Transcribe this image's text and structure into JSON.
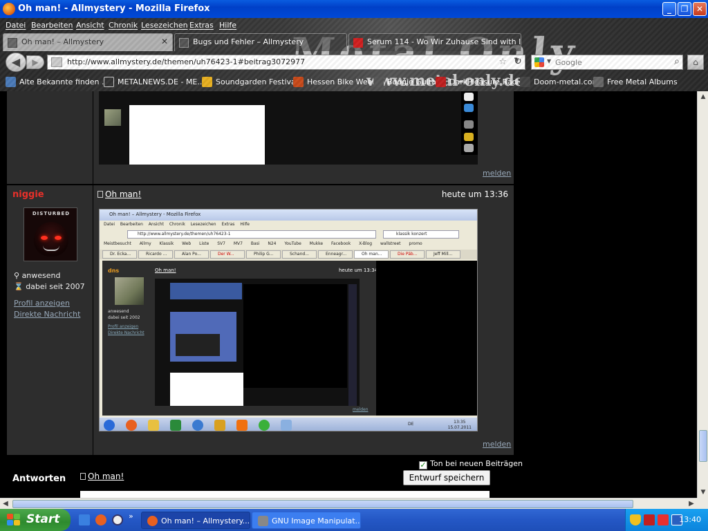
{
  "window": {
    "title": "Oh man! - Allmystery - Mozilla Firefox",
    "controls": [
      "_",
      "❐",
      "✕"
    ]
  },
  "menu": [
    "Datei",
    "Bearbeiten",
    "Ansicht",
    "Chronik",
    "Lesezeichen",
    "Extras",
    "Hilfe"
  ],
  "theme": {
    "logo": "Metal Only",
    "url": "www.metal-only.de"
  },
  "tabs": [
    {
      "label": "Oh man! – Allmystery",
      "active": true,
      "close": "✕"
    },
    {
      "label": "Bugs und Fehler – Allmystery",
      "active": false
    },
    {
      "label": "Serum 114 - Wo Wir Zuhause Sind with ly...",
      "active": false
    }
  ],
  "nav": {
    "url": "http://www.allmystery.de/themen/uh76423-1#beitrag3072977",
    "search_placeholder": "Google"
  },
  "bookmarks": [
    "Alte Bekannte finden ...",
    "METALNEWS.DE - ME...",
    "Soundgarden Festival",
    "Hessen Bike Week",
    "Boogie Guitar",
    "DarkPleasure Radio",
    "Doom-metal.com",
    "Free Metal Albums"
  ],
  "post1": {
    "melden": "melden"
  },
  "post2": {
    "username": "niggie",
    "avatar_text": "DISTURBED",
    "status_online": "anwesend",
    "member_since": "dabei seit 2007",
    "profile_link": "Profil anzeigen",
    "message_link": "Direkte Nachricht",
    "title": "Oh man!",
    "time": "heute um 13:36",
    "melden": "melden"
  },
  "nested": {
    "title": "Oh man! – Allmystery - Mozilla Firefox",
    "menu": "Datei Bearbeiten Ansicht Chronik Lesezeichen Extras Hilfe",
    "url": "http://www.allmystery.de/themen/uh76423-1",
    "search": "klassik konzert",
    "bookmarks": "Meistbesucht Allmy Klassik Web Liste SV7 MV7 Basi N24 YouTube Mukke Facebook X-Blog wallstreet promo",
    "tabs": [
      "Dr. Ecka...",
      "Ricardo ...",
      "Alan Po...",
      "Der W...",
      "Philip G...",
      "Schand...",
      "Enneagr...",
      "Oh man...",
      "Die Päb...",
      "Jeff Mill..."
    ],
    "username": "dns",
    "status": "anwesend",
    "since": "dabei seit 2002",
    "profile": "Profil anzeigen",
    "message": "Direkte Nachricht",
    "post_title": "Oh man!",
    "post_time": "heute um 13:34",
    "melden": "melden",
    "lang": "DE",
    "clock_time": "13:35",
    "clock_date": "15.07.2011"
  },
  "reply": {
    "label": "Antworten",
    "title": "Oh man!",
    "checkbox_label": "Ton bei neuen Beiträgen",
    "checkbox_checked": true,
    "draft_button": "Entwurf speichern"
  },
  "taskbar": {
    "start": "Start",
    "items": [
      {
        "label": "Oh man! – Allmystery...",
        "active": true
      },
      {
        "label": "GNU Image Manipulat...",
        "active": false
      }
    ],
    "time": "13:40"
  },
  "colors": {
    "username": "#e8302a",
    "link": "#99aabb",
    "xp_blue": "#2457c5",
    "start_green": "#2e8a2e"
  }
}
